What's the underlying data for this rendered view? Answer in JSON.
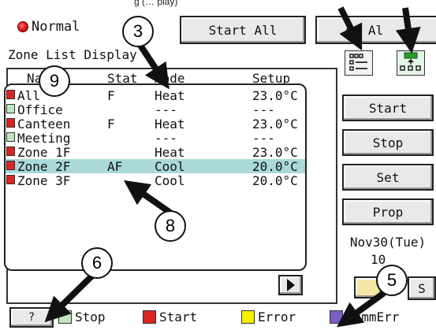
{
  "top_partial_text": "g (… play)",
  "status": {
    "label": "Normal"
  },
  "buttons": {
    "start_all": "Start All",
    "stop_all_partial": "op Al"
  },
  "zone_list": {
    "title": "Zone List Display",
    "headers": {
      "name": "Na",
      "stat": "Stat",
      "mode": "Mode",
      "setup": "Setup"
    },
    "rows": [
      {
        "swatch": "#dd2222",
        "name": "All",
        "stat": "F",
        "mode": "Heat",
        "setup": "23.0°C"
      },
      {
        "swatch": "#bfe6bf",
        "name": "Office",
        "stat": "",
        "mode": "---",
        "setup": "---"
      },
      {
        "swatch": "#dd2222",
        "name": "Canteen",
        "stat": "F",
        "mode": "Heat",
        "setup": "23.0°C"
      },
      {
        "swatch": "#bfe6bf",
        "name": "Meeting",
        "stat": "",
        "mode": "---",
        "setup": "---"
      },
      {
        "swatch": "#dd2222",
        "name": "Zone 1F",
        "stat": "",
        "mode": "Heat",
        "setup": "23.0°C"
      },
      {
        "swatch": "#dd2222",
        "name": "Zone 2F",
        "stat": "AF",
        "mode": "Cool",
        "setup": "20.0°C",
        "selected": true
      },
      {
        "swatch": "#dd2222",
        "name": "Zone 3F",
        "stat": "",
        "mode": "Cool",
        "setup": "20.0°C"
      }
    ]
  },
  "side_buttons": {
    "start": "Start",
    "stop": "Stop",
    "set": "Set",
    "prop": "Prop",
    "s": "S"
  },
  "icons": {
    "list_view": "list-view-icon",
    "group_view": "group-view-icon",
    "scroll_right": "scroll-right-icon"
  },
  "datetime": {
    "date": "Nov30(Tue)",
    "time_partial": "10"
  },
  "help_button": "?",
  "legend": [
    {
      "color": "#bfe6bf",
      "label": "Stop"
    },
    {
      "color": "#dd2222",
      "label": "Start"
    },
    {
      "color": "#f5f000",
      "label": "Error"
    },
    {
      "color": "#7e5cc0",
      "label": "CommErr"
    }
  ],
  "callouts": [
    "3",
    "9",
    "8",
    "6",
    "5"
  ],
  "colors": {
    "selected_row": "#a9d9d9",
    "group_icon": "#2a9a2a"
  }
}
